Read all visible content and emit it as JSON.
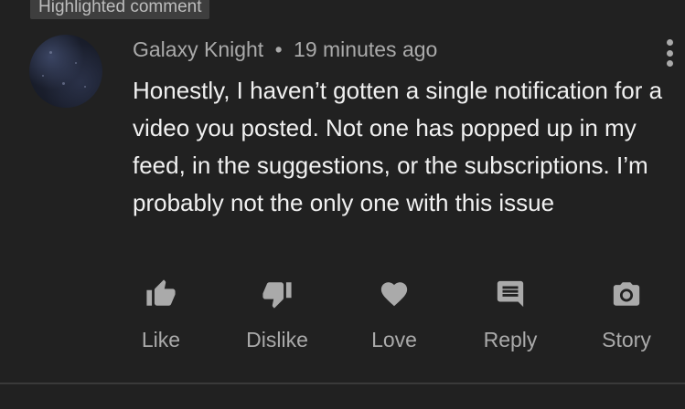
{
  "badge": {
    "label": "Highlighted comment"
  },
  "comment": {
    "author": "Galaxy Knight",
    "separator": "•",
    "time": "19 minutes ago",
    "text": "Honestly, I haven’t gotten a single notification for a video you posted. Not one has popped up in my feed, in the suggestions, or the subscriptions. I’m probably not the only one with this issue",
    "menu_icon": "more-vertical-icon"
  },
  "actions": [
    {
      "label": "Like",
      "icon": "thumbs-up-icon"
    },
    {
      "label": "Dislike",
      "icon": "thumbs-down-icon"
    },
    {
      "label": "Love",
      "icon": "heart-icon"
    },
    {
      "label": "Reply",
      "icon": "reply-comment-icon"
    },
    {
      "label": "Story",
      "icon": "camera-icon"
    }
  ],
  "colors": {
    "background": "#212121",
    "primary_text": "#f1f1f1",
    "secondary_text": "#aaaaaa",
    "badge_bg": "#3e3e3e"
  }
}
